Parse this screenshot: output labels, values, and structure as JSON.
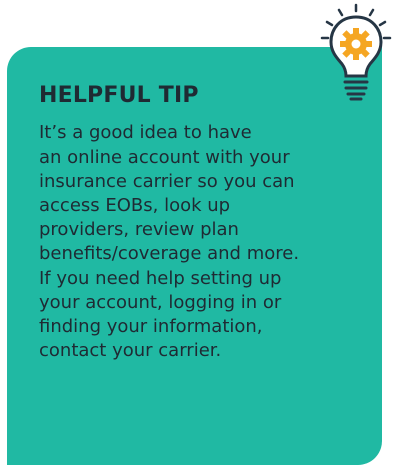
{
  "tip": {
    "title": "HELPFUL TIP",
    "body": "It’s a good idea to have\nan online account with your\ninsurance carrier so you can\naccess EOBs, look up\nproviders, review plan\nbenefits/coverage and more.\nIf you need help setting up\nyour account, logging in or\nfinding your information,\ncontact your carrier."
  },
  "colors": {
    "card_background": "#20b9a3",
    "text": "#1f2a33",
    "icon_outline": "#263645",
    "gear": "#f5a623"
  },
  "icons": [
    "lightbulb-gear-icon"
  ]
}
